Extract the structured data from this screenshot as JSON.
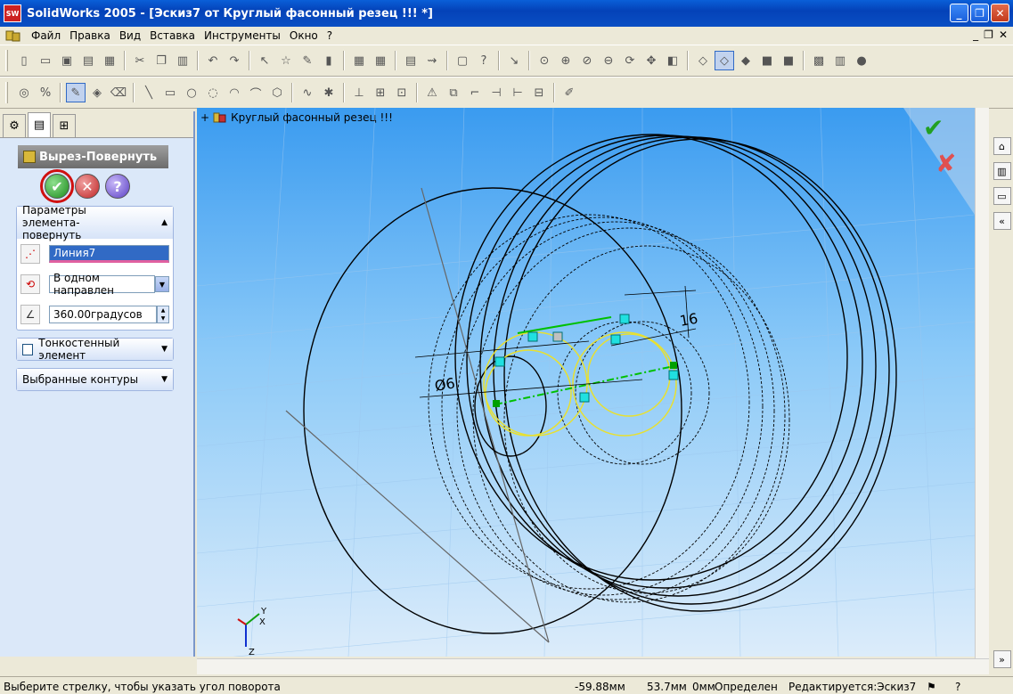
{
  "window": {
    "title": "SolidWorks 2005 - [Эскиз7 от Круглый фасонный резец !!! *]",
    "app_icon": "SW"
  },
  "menu": [
    "Файл",
    "Правка",
    "Вид",
    "Вставка",
    "Инструменты",
    "Окно",
    "?"
  ],
  "property_manager": {
    "feature_title": "Вырез-Повернуть",
    "group_params_title": "Параметры элемента-повернуть",
    "axis_value": "Линия7",
    "direction_value": "В одном направлен",
    "angle_value": "360.00градусов",
    "thin_feature_label": "Тонкостенный элемент",
    "selected_contours_label": "Выбранные контуры"
  },
  "viewport": {
    "tree_root_label": "Круглый фасонный резец !!!",
    "dim_left": "Ø6",
    "dim_right": "16",
    "axis_x": "X",
    "axis_y": "Y",
    "axis_z": "Z"
  },
  "statusbar": {
    "hint": "Выберите стрелку, чтобы указать угол поворота",
    "x": "-59.88мм",
    "y": "53.7мм",
    "z": "0мм",
    "state": "Определен",
    "editing": "Редактируется:Эскиз7"
  },
  "colors": {
    "titlebar": "#0a4fc4",
    "viewport_top": "#3a9bf0",
    "viewport_bottom": "#dcecfa",
    "sketch_green": "#00c000",
    "ok_red": "#d01010"
  }
}
